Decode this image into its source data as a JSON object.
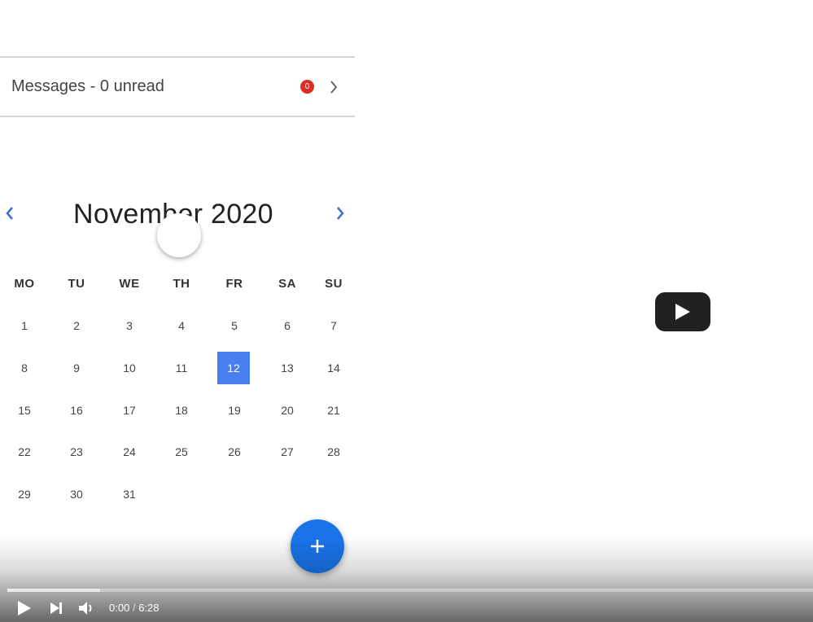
{
  "messages": {
    "label": "Messages - 0 unread",
    "badge": "0"
  },
  "calendar": {
    "title": "November 2020",
    "weekdays": [
      "MO",
      "TU",
      "WE",
      "TH",
      "FR",
      "SA",
      "SU"
    ],
    "weeks": [
      [
        "1",
        "2",
        "3",
        "4",
        "5",
        "6",
        "7"
      ],
      [
        "8",
        "9",
        "10",
        "11",
        "12",
        "13",
        "14"
      ],
      [
        "15",
        "16",
        "17",
        "18",
        "19",
        "20",
        "21"
      ],
      [
        "22",
        "23",
        "24",
        "25",
        "26",
        "27",
        "28"
      ],
      [
        "29",
        "30",
        "31",
        "",
        "",
        "",
        ""
      ]
    ],
    "selected_day": "12"
  },
  "fab": {
    "icon": "plus-icon"
  },
  "video": {
    "current_time": "0:00",
    "separator": "/",
    "duration": "6:28",
    "loaded_fraction": 0.115,
    "icons": [
      "play-icon",
      "next-icon",
      "volume-icon",
      "large-play-icon"
    ]
  },
  "colors": {
    "accent": "#1a73e8",
    "selected_day": "#4a7ff0",
    "badge": "#d93025",
    "nav_arrow": "#3b6fd8"
  }
}
